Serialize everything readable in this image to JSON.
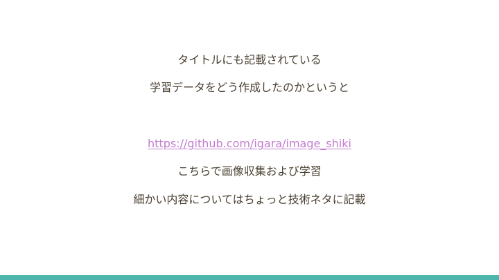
{
  "slide": {
    "lines": [
      "タイトルにも記載されている",
      "学習データをどう作成したのかというと",
      "",
      "https://github.com/igara/image_shiki",
      "こちらで画像収集および学習",
      "細かい内容についてはちょっと技術ネタに記載"
    ],
    "link_index": 3
  },
  "colors": {
    "text": "#4a4032",
    "link": "#c27bd0",
    "accent_bar": "#4db6ac",
    "background": "#ffffff"
  }
}
